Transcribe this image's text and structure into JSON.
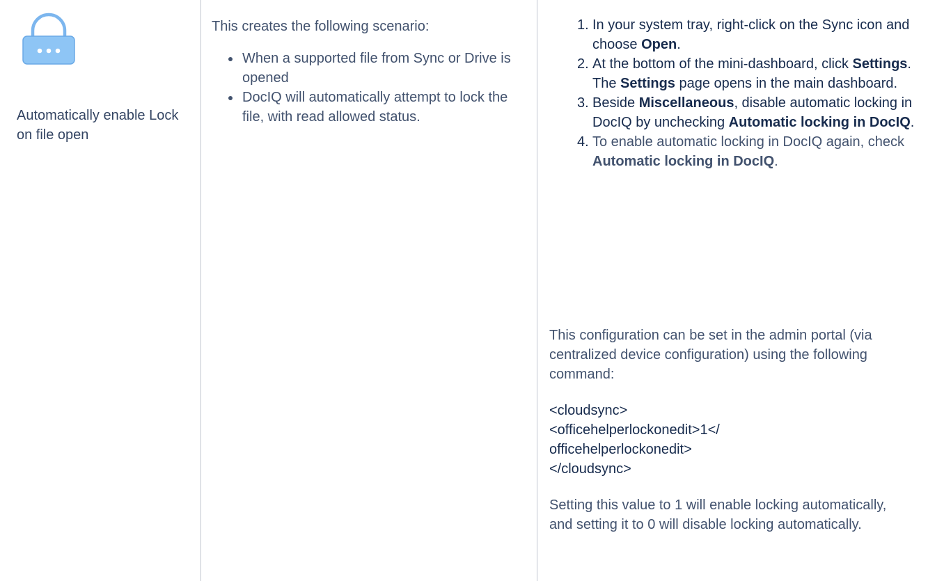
{
  "feature": {
    "icon": "lock-icon",
    "name": "Automatically enable Lock on file open"
  },
  "description": {
    "intro": "This creates the following scenario:",
    "bullets": [
      "When a supported file from Sync or Drive is opened",
      "DocIQ will automatically attempt to lock the file, with read allowed status."
    ]
  },
  "instructions": {
    "steps": [
      {
        "num": "1.",
        "pre": "In your system tray, right-click on the Sync icon and choose ",
        "bold": "Open",
        "post": "."
      },
      {
        "num": "2.",
        "pre": "At the bottom of the mini-dashboard, click ",
        "bold": "Settings",
        "post": ".",
        "sub_bold": "Settings",
        "sub_text": " page opens in the main dashboard.",
        "sub_pre": "The "
      },
      {
        "num": "3.",
        "pre": "Beside ",
        "bold": "Miscellaneous",
        "mid": ", disable automatic locking in DocIQ by unchecking ",
        "bold2": "Automatic locking in DocIQ",
        "post": "."
      },
      {
        "num": "4.",
        "pre": "To enable automatic locking in DocIQ again, check ",
        "bold": "Automatic locking in DocIQ",
        "post": "."
      }
    ],
    "config_intro": "This configuration can be set in the admin portal (via centralized device configuration) using the following command:",
    "code_lines": [
      "<cloudsync>",
      "<officehelperlockonedit>1</",
      "officehelperlockonedit>",
      "</cloudsync>"
    ],
    "closing": "Setting this value to 1 will enable locking automatically, and setting it to 0 will disable locking automatically."
  }
}
